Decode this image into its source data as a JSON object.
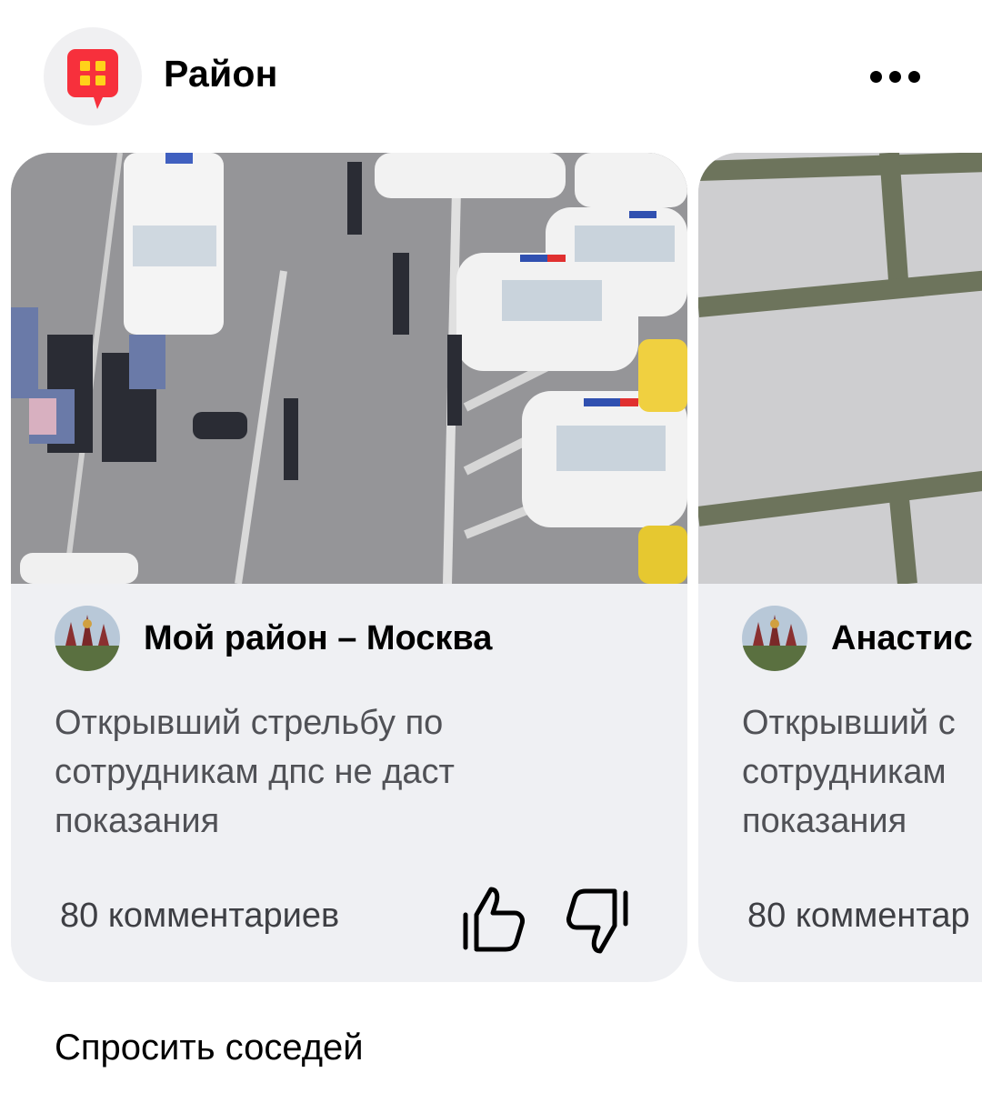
{
  "header": {
    "app_title": "Район",
    "logo_icon": "rayon-speech-bubble-icon",
    "more_icon": "more-dots-icon"
  },
  "cards": [
    {
      "author": "Мой район – Москва",
      "text": "Открывший стрельбу по сотрудникам дпс не даст показания",
      "comments": "80 комментариев"
    },
    {
      "author": "Анастис",
      "text": "Открывший с сотрудникам показания",
      "comments": "80 комментар"
    }
  ],
  "footer": {
    "ask_label": "Спросить соседей"
  },
  "colors": {
    "brand_red": "#f7303c",
    "brand_yellow": "#ffd21a",
    "card_bg": "#eff0f3",
    "avatar_bg": "#f0f0f2"
  }
}
